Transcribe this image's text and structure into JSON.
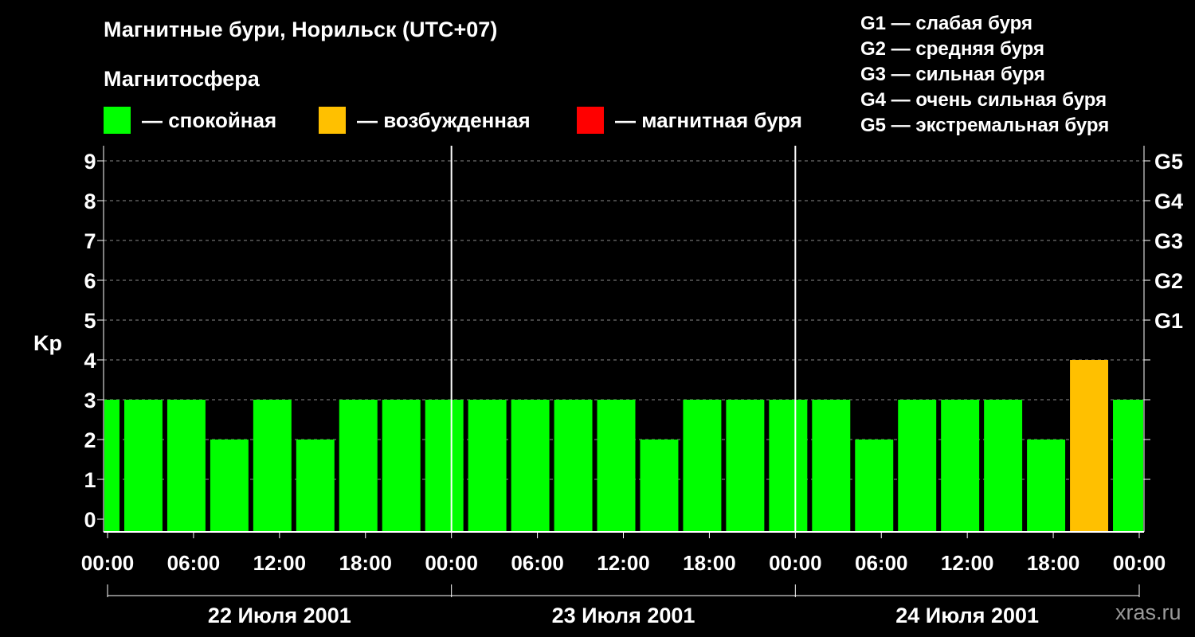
{
  "header": {
    "title": "Магнитные бури, Норильск (UTC+07)",
    "subtitle": "Магнитосфера"
  },
  "legend": [
    {
      "label": "— спокойная",
      "color": "#00ff00"
    },
    {
      "label": "— возбужденная",
      "color": "#ffc000"
    },
    {
      "label": "— магнитная буря",
      "color": "#ff0000"
    }
  ],
  "g_legend": [
    "G1 — слабая буря",
    "G2 — средняя буря",
    "G3 — сильная буря",
    "G4 — очень сильная буря",
    "G5 — экстремальная буря"
  ],
  "watermark": "xras.ru",
  "chart_data": {
    "type": "bar",
    "ylabel": "Kp",
    "ylim": [
      0,
      9
    ],
    "yticks": [
      0,
      1,
      2,
      3,
      4,
      5,
      6,
      7,
      8,
      9
    ],
    "right_ticks": [
      {
        "value": 5,
        "label": "G1"
      },
      {
        "value": 6,
        "label": "G2"
      },
      {
        "value": 7,
        "label": "G3"
      },
      {
        "value": 8,
        "label": "G4"
      },
      {
        "value": 9,
        "label": "G5"
      }
    ],
    "xlim_hours": [
      0,
      72
    ],
    "xtick_labels": [
      "00:00",
      "06:00",
      "12:00",
      "18:00",
      "00:00",
      "06:00",
      "12:00",
      "18:00",
      "00:00",
      "06:00",
      "12:00",
      "18:00",
      "00:00"
    ],
    "days": [
      "22 Июля 2001",
      "23 Июля 2001",
      "24 Июля 2001"
    ],
    "grid": true,
    "colors": {
      "quiet": "#00ff00",
      "active": "#ffc000",
      "storm": "#ff0000"
    },
    "bars": [
      {
        "start": -2,
        "end": 1,
        "kp": 3,
        "level": "quiet"
      },
      {
        "start": 1,
        "end": 4,
        "kp": 3,
        "level": "quiet"
      },
      {
        "start": 4,
        "end": 7,
        "kp": 3,
        "level": "quiet"
      },
      {
        "start": 7,
        "end": 10,
        "kp": 2,
        "level": "quiet"
      },
      {
        "start": 10,
        "end": 13,
        "kp": 3,
        "level": "quiet"
      },
      {
        "start": 13,
        "end": 16,
        "kp": 2,
        "level": "quiet"
      },
      {
        "start": 16,
        "end": 19,
        "kp": 3,
        "level": "quiet"
      },
      {
        "start": 19,
        "end": 22,
        "kp": 3,
        "level": "quiet"
      },
      {
        "start": 22,
        "end": 25,
        "kp": 3,
        "level": "quiet"
      },
      {
        "start": 25,
        "end": 28,
        "kp": 3,
        "level": "quiet"
      },
      {
        "start": 28,
        "end": 31,
        "kp": 3,
        "level": "quiet"
      },
      {
        "start": 31,
        "end": 34,
        "kp": 3,
        "level": "quiet"
      },
      {
        "start": 34,
        "end": 37,
        "kp": 3,
        "level": "quiet"
      },
      {
        "start": 37,
        "end": 40,
        "kp": 2,
        "level": "quiet"
      },
      {
        "start": 40,
        "end": 43,
        "kp": 3,
        "level": "quiet"
      },
      {
        "start": 43,
        "end": 46,
        "kp": 3,
        "level": "quiet"
      },
      {
        "start": 46,
        "end": 49,
        "kp": 3,
        "level": "quiet"
      },
      {
        "start": 49,
        "end": 52,
        "kp": 3,
        "level": "quiet"
      },
      {
        "start": 52,
        "end": 55,
        "kp": 2,
        "level": "quiet"
      },
      {
        "start": 55,
        "end": 58,
        "kp": 3,
        "level": "quiet"
      },
      {
        "start": 58,
        "end": 61,
        "kp": 3,
        "level": "quiet"
      },
      {
        "start": 61,
        "end": 64,
        "kp": 3,
        "level": "quiet"
      },
      {
        "start": 64,
        "end": 67,
        "kp": 2,
        "level": "quiet"
      },
      {
        "start": 67,
        "end": 70,
        "kp": 4,
        "level": "active"
      },
      {
        "start": 70,
        "end": 73,
        "kp": 3,
        "level": "quiet"
      }
    ]
  }
}
